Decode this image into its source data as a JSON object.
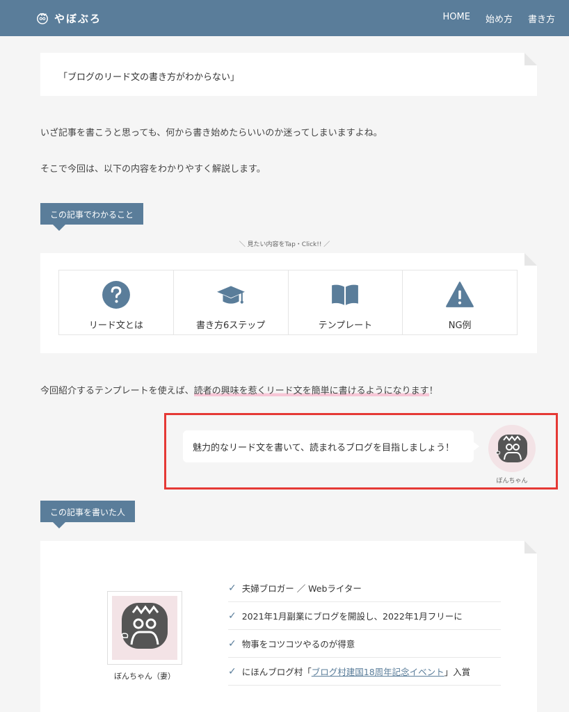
{
  "header": {
    "logo_text": "やぼぶろ",
    "nav": [
      "HOME",
      "始め方",
      "書き方"
    ]
  },
  "intro": {
    "quote": "「ブログのリード文の書き方がわからない」",
    "para1": "いざ記事を書こうと思っても、何から書き始めたらいいのか迷ってしまいますよね。",
    "para2": "そこで今回は、以下の内容をわかりやすく解説します。"
  },
  "toc": {
    "tag": "この記事でわかること",
    "hint": "＼ 見たい内容をTap・Click!! ／",
    "items": [
      {
        "label": "リード文とは",
        "icon": "question-circle-icon"
      },
      {
        "label": "書き方6ステップ",
        "icon": "graduation-cap-icon"
      },
      {
        "label": "テンプレート",
        "icon": "open-book-icon"
      },
      {
        "label": "NG例",
        "icon": "warning-triangle-icon"
      }
    ]
  },
  "promo": {
    "prefix": "今回紹介するテンプレートを使えば、",
    "highlight": "読者の興味を惹くリード文を簡単に書けるようになります",
    "suffix": "！"
  },
  "speech": {
    "text": "魅力的なリード文を書いて、読まれるブログを目指しましょう！",
    "speaker": "ぼんちゃん"
  },
  "author": {
    "tag": "この記事を書いた人",
    "name": "ぼんちゃん（妻）",
    "facts": [
      "夫婦ブロガー ／ Webライター",
      "2021年1月副業にブログを開設し、2022年1月フリーに",
      "物事をコツコツやるのが得意"
    ],
    "award_prefix": "にほんブログ村「",
    "award_link": "ブログ村建国18周年記念イベント",
    "award_suffix": "」入賞"
  },
  "colors": {
    "header": "#5a7d9a",
    "accent": "#5a7d9a",
    "highlight": "#f7c6d6",
    "alert_border": "#e53935"
  }
}
